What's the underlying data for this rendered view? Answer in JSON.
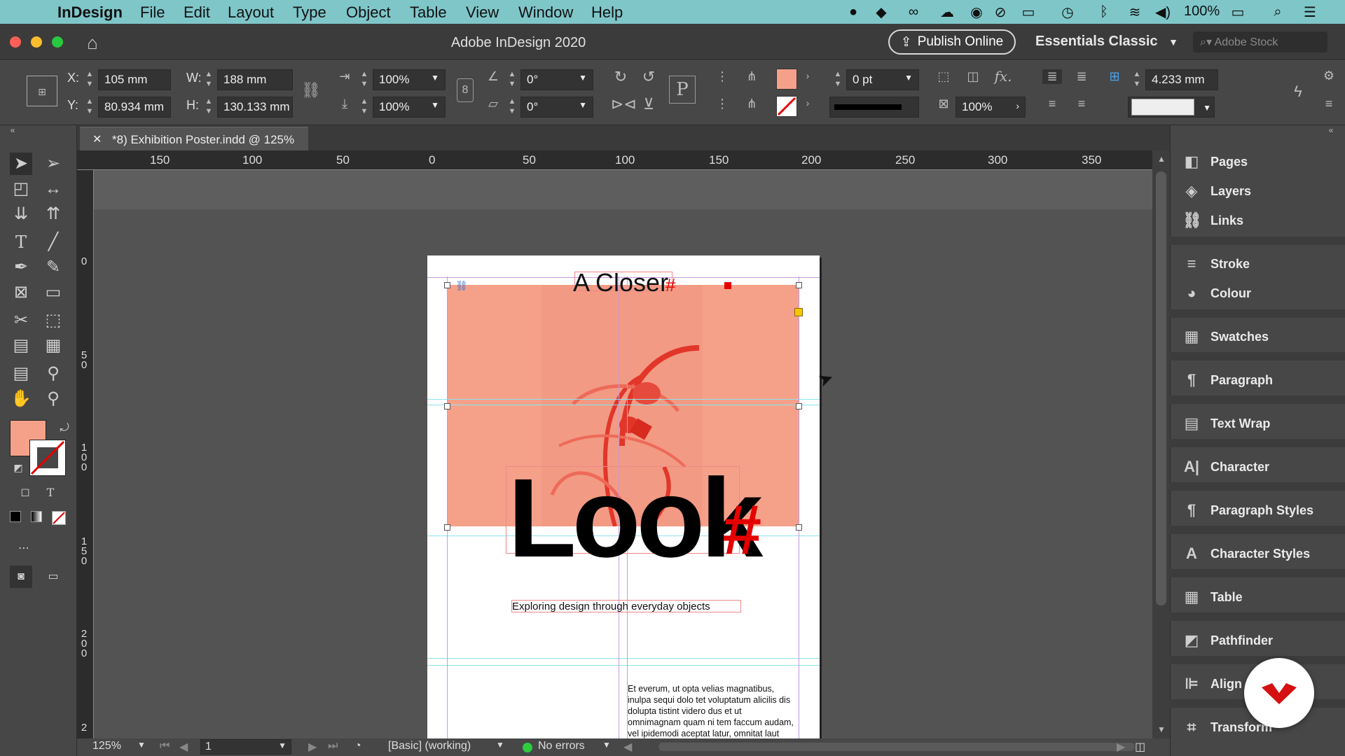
{
  "menubar": {
    "app_name": "InDesign",
    "items": [
      "File",
      "Edit",
      "Layout",
      "Type",
      "Object",
      "Table",
      "View",
      "Window",
      "Help"
    ],
    "battery": "100%"
  },
  "window": {
    "title": "Adobe InDesign 2020",
    "publish_label": "Publish Online",
    "workspace_label": "Essentials Classic",
    "stock_placeholder": "Adobe Stock"
  },
  "control": {
    "x_label": "X:",
    "x_value": "105 mm",
    "y_label": "Y:",
    "y_value": "80.934 mm",
    "w_label": "W:",
    "w_value": "188 mm",
    "h_label": "H:",
    "h_value": "130.133 mm",
    "scale_x": "100%",
    "scale_y": "100%",
    "rotate": "0°",
    "shear": "0°",
    "stroke_weight": "0 pt",
    "opacity": "100%",
    "spacing": "4.233 mm",
    "fill_color": "#f5a18a"
  },
  "doc_tab": {
    "title": "*8) Exhibition Poster.indd @ 125%"
  },
  "ruler": {
    "h_labels": [
      "150",
      "100",
      "50",
      "0",
      "50",
      "100",
      "150",
      "200",
      "250",
      "300",
      "350"
    ],
    "v_labels": [
      "0",
      "50",
      "100",
      "150",
      "200",
      "2"
    ]
  },
  "poster": {
    "headline_top": "A Closer",
    "headline_big": "Look",
    "subtitle": "Exploring design through everyday objects",
    "body": "Et everum, ut opta velias magnatibus, inulpa sequi dolo tet voluptatum alicilis dis dolupta tistint videro dus et ut omnimagnam quam ni tem faccum audam, vel ipidemodi aceptat latur, omnitat laut",
    "accent_color": "#e40000",
    "image_tint": "#f5a18a"
  },
  "panels": [
    "Pages",
    "Layers",
    "Links",
    "Stroke",
    "Colour",
    "Swatches",
    "Paragraph",
    "Text Wrap",
    "Character",
    "Paragraph Styles",
    "Character Styles",
    "Table",
    "Pathfinder",
    "Align",
    "Transform"
  ],
  "status": {
    "zoom": "125%",
    "page": "1",
    "style": "[Basic] (working)",
    "errors": "No errors"
  }
}
